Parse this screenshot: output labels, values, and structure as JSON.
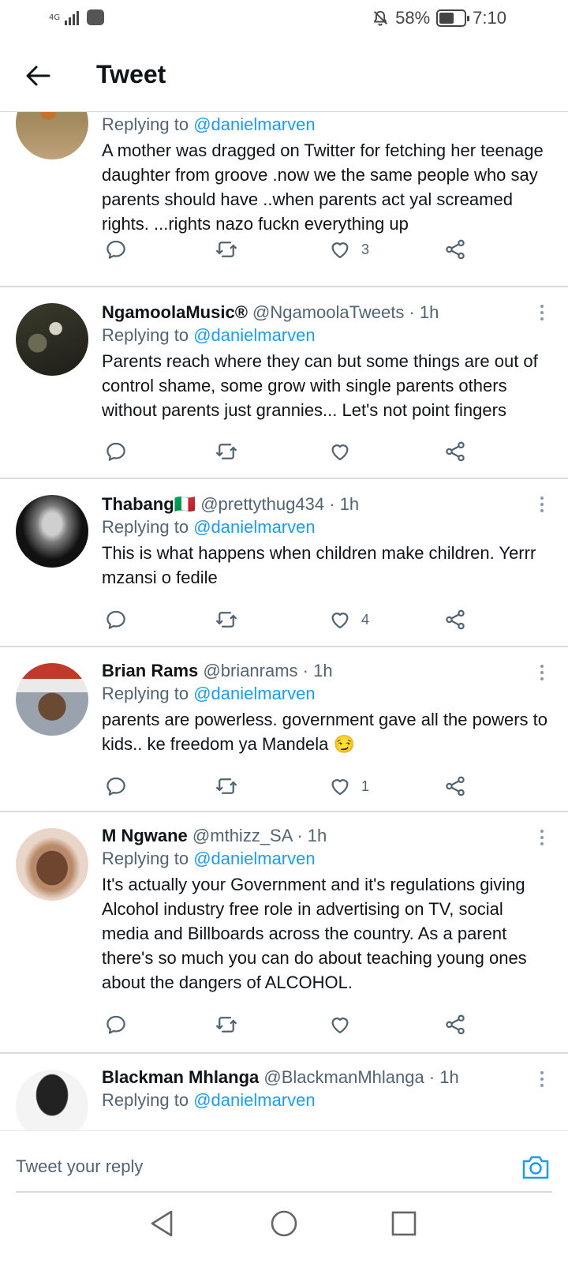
{
  "status_bar": {
    "network": "4G",
    "battery_percent": "58%",
    "battery_level": 0.58,
    "time": "7:10",
    "icons": [
      "signal-icon",
      "huawei-icon",
      "mute-icon",
      "battery-icon"
    ]
  },
  "header": {
    "title": "Tweet",
    "back_icon": "arrow-left-icon"
  },
  "tweets": [
    {
      "name": "",
      "handle": "",
      "time": "",
      "replying_prefix": "Replying to ",
      "replying_to": "@danielmarven",
      "text": "A mother was dragged on Twitter for fetching her teenage daughter from groove .now we the same people who say parents should have   ..when parents act yal screamed rights. ...rights nazo fuckn everything up",
      "likes": "3"
    },
    {
      "name": "NgamoolaMusic®",
      "handle": "@NgamoolaTweets",
      "time": "· 1h",
      "replying_prefix": "Replying to ",
      "replying_to": "@danielmarven",
      "text": "Parents reach where they can but some things are out of control shame, some grow with single parents others without parents just grannies... Let's not point fingers",
      "likes": ""
    },
    {
      "name": "Thabang🇮🇹",
      "handle": "@prettythug434",
      "time": "· 1h",
      "replying_prefix": "Replying to ",
      "replying_to": "@danielmarven",
      "text": "This is what happens when children make children. Yerrr mzansi o fedile",
      "likes": "4"
    },
    {
      "name": "Brian Rams",
      "handle": "@brianrams",
      "time": "· 1h",
      "replying_prefix": "Replying to ",
      "replying_to": "@danielmarven",
      "text": "parents are powerless.  government gave all the powers to kids.. ke freedom ya Mandela 😏",
      "likes": "1"
    },
    {
      "name": "M Ngwane",
      "handle": "@mthizz_SA",
      "time": "· 1h",
      "replying_prefix": "Replying to ",
      "replying_to": "@danielmarven",
      "text": "It's actually your Government and it's regulations giving Alcohol industry free role in advertising on TV, social media and Billboards across the country. As a parent there's so much you can do about teaching young ones about the dangers of ALCOHOL.",
      "likes": ""
    },
    {
      "name": "Blackman Mhlanga",
      "handle": "@BlackmanMhlanga",
      "time": "· 1h",
      "replying_prefix": "Replying to ",
      "replying_to": "@danielmarven",
      "text": "",
      "likes": ""
    }
  ],
  "reply_bar": {
    "placeholder": "Tweet your reply",
    "camera_icon": "camera-icon"
  },
  "nav": {
    "icons": [
      "back-triangle-icon",
      "home-circle-icon",
      "recents-square-icon"
    ]
  },
  "colors": {
    "accent": "#1d9bf0",
    "text": "#0f1419",
    "secondary": "#536471",
    "divider": "#d9dcdf"
  }
}
